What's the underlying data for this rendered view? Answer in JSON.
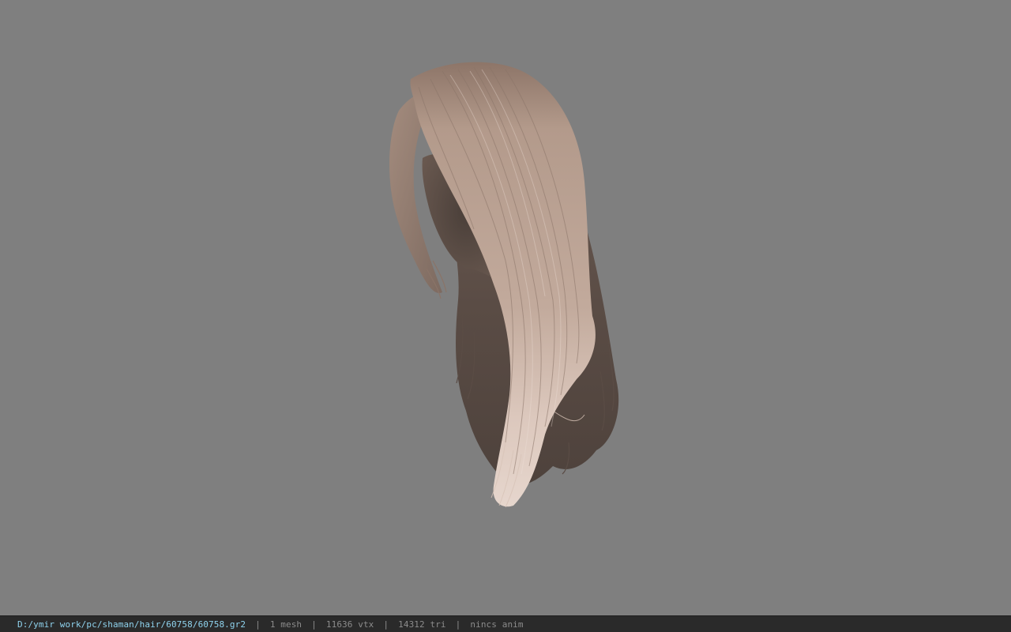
{
  "viewport": {
    "background": "#7f7f7f",
    "model": {
      "name": "hair-mesh",
      "hair_root_color": "#7d6a60",
      "hair_mid_color": "#b19888",
      "hair_tip_color": "#e2cfc6"
    }
  },
  "status_bar": {
    "path": "D:/ymir work/pc/shaman/hair/60758/60758.gr2",
    "separator": "|",
    "mesh_count": "1 mesh",
    "vertex_count": "11636 vtx",
    "triangle_count": "14312 tri",
    "anim_status": "nincs anim",
    "path_color": "#8fd3ee",
    "text_color": "#8c8c8c"
  }
}
